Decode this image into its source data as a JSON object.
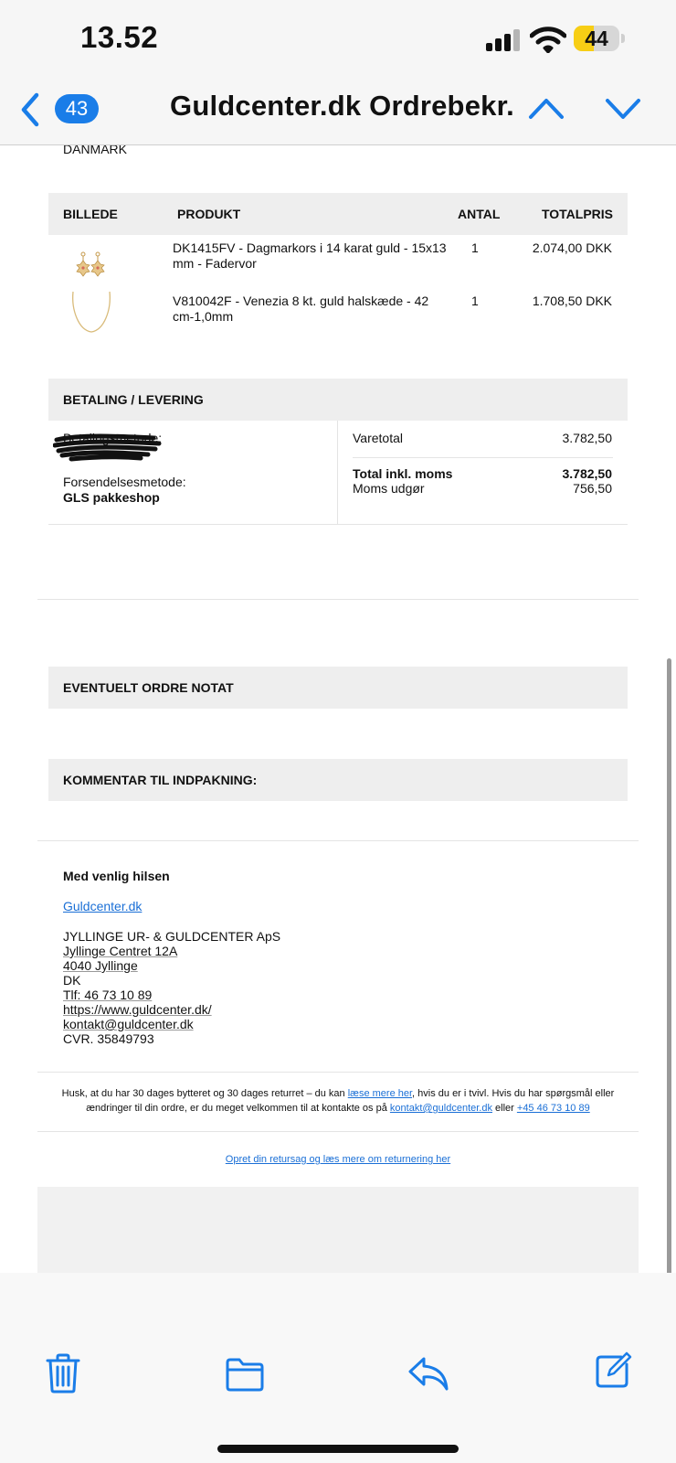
{
  "status": {
    "time": "13.52",
    "battery": "44",
    "battery_level": 0.44
  },
  "nav": {
    "unread_count": "43",
    "title": "Guldcenter.dk Ordrebekr..."
  },
  "email": {
    "country": "DANMARK",
    "table_headers": {
      "image": "BILLEDE",
      "product": "PRODUKT",
      "qty": "ANTAL",
      "total": "TOTALPRIS"
    },
    "items": [
      {
        "name": "DK1415FV - Dagmarkors i 14 karat guld - 15x13 mm - Fadervor",
        "qty": "1",
        "price": "2.074,00 DKK",
        "image_icon": "cross-earrings-image"
      },
      {
        "name": "V810042F - Venezia 8 kt. guld halskæde - 42 cm-1,0mm",
        "qty": "1",
        "price": "1.708,50 DKK",
        "image_icon": "gold-necklace-image"
      }
    ],
    "payment": {
      "header": "BETALING / LEVERING",
      "payment_method_label": "Betalingsmetode:",
      "shipping_method_label": "Forsendelsesmetode:",
      "shipping_method_value": "GLS pakkeshop",
      "subtotal_label": "Varetotal",
      "subtotal_value": "3.782,50",
      "total_label": "Total inkl. moms",
      "total_value": "3.782,50",
      "vat_label": "Moms udgør",
      "vat_value": "756,50"
    },
    "order_note_header": "EVENTUELT ORDRE NOTAT",
    "packaging_comment_header": "KOMMENTAR TIL INDPAKNING:",
    "signature": {
      "greeting": "Med venlig hilsen",
      "site_link": "Guldcenter.dk",
      "company": "JYLLINGE UR- & GULDCENTER ApS",
      "street": "Jyllinge Centret 12A",
      "city": "4040 Jyllinge",
      "country": "DK",
      "phone": "Tlf: 46 73 10 89",
      "website": "https://www.guldcenter.dk/",
      "email": "kontakt@guldcenter.dk",
      "cvr": "CVR. 35849793"
    },
    "footer": {
      "t1": "Husk, at du har 30 dages bytteret og 30 dages returret – du kan ",
      "link1": "læse mere her",
      "t2": ", hvis du er i tvivl. Hvis du har spørgsmål eller ændringer til din ordre, er du meget velkommen til at kontakte os på ",
      "link2": "kontakt@guldcenter.dk",
      "t3": " eller ",
      "link3": "+45 46 73 10 89",
      "returns_link": "Opret din retursag og læs mere om returnering her"
    }
  },
  "colors": {
    "accent": "#1a7de8",
    "battery": "#f7ce15",
    "section_bg": "#eeeeee"
  },
  "toolbar": {
    "icons": [
      "trash-icon",
      "folder-icon",
      "reply-icon",
      "compose-icon"
    ]
  }
}
